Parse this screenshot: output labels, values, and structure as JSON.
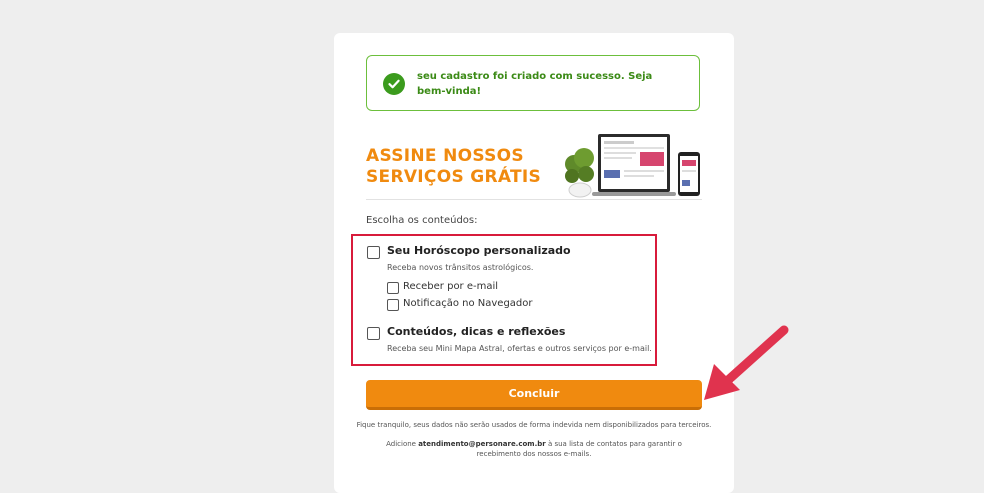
{
  "success": {
    "message": "seu cadastro foi criado com sucesso. Seja bem-vinda!"
  },
  "promo": {
    "title_line1": "ASSINE NOSSOS",
    "title_line2": "SERVIÇOS GRÁTIS"
  },
  "form": {
    "choose_label": "Escolha os conteúdos:",
    "horoscope": {
      "title": "Seu Horóscopo personalizado",
      "subtitle": "Receba novos trânsitos astrológicos.",
      "email_label": "Receber por e-mail",
      "browser_label": "Notificação no Navegador"
    },
    "content": {
      "title": "Conteúdos, dicas e reflexões",
      "subtitle": "Receba seu Mini Mapa Astral, ofertas e outros serviços por e-mail."
    },
    "submit_label": "Concluir"
  },
  "footer": {
    "privacy": "Fique tranquilo, seus dados não serão usados de forma indevida nem disponibilizados para terceiros.",
    "contact_prefix": "Adicione ",
    "contact_email": "atendimento@personare.com.br",
    "contact_suffix": " à sua lista de contatos para garantir o recebimento dos nossos e-mails."
  },
  "colors": {
    "accent": "#f08a0f",
    "success": "#3b9b1d",
    "highlight": "#d81b3b"
  }
}
